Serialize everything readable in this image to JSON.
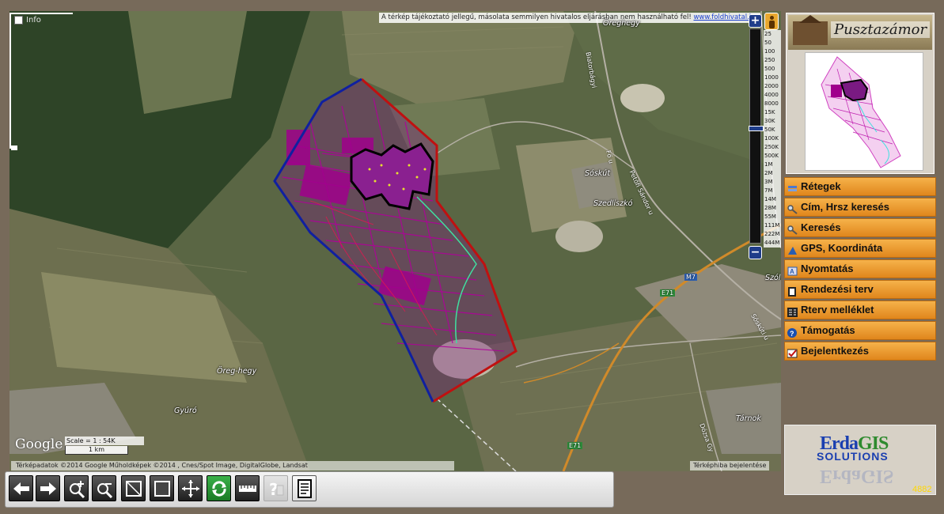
{
  "map": {
    "notice_text": "A térkép tájékoztató jellegű, másolata semmilyen hivatalos eljárásban nem használható fel!",
    "notice_link": "www.foldhivatal.hu",
    "info_label": "Info",
    "places": {
      "oreghegy_top": "Öreghegy",
      "soskut": "Sóskút",
      "szedliszko": "Szedliszkó",
      "oreg_hegy": "Öreg-hegy",
      "gyuro": "Gyúró",
      "tarnok": "Tárnok",
      "szol": "Szól"
    },
    "roads": {
      "biatori": "Biatorbágyi",
      "fo_u": "Fő u",
      "petofi": "Petőfi Sándor u",
      "soskuti": "Sóskúti u",
      "dozsa": "Dózsa Gy",
      "m7": "M7",
      "e71a": "E71",
      "e71b": "E71"
    },
    "google_label": "Google",
    "scale_label": "Scale = 1 : 54K",
    "scale_bar": "1 km",
    "attribution": "Térképadatok ©2014 Google Műholdképek ©2014 , Cnes/Spot Image, DigitalGlobe, Landsat",
    "report_link": "Térképhiba bejelentése"
  },
  "zoom": {
    "levels": [
      "25",
      "50",
      "100",
      "250",
      "500",
      "1000",
      "2000",
      "4000",
      "8000",
      "15K",
      "30K",
      "50K",
      "100K",
      "250K",
      "500K",
      "1M",
      "2M",
      "3M",
      "7M",
      "14M",
      "28M",
      "55M",
      "111M",
      "222M",
      "444M"
    ],
    "current_level": "50K",
    "plus": "+",
    "minus": "−"
  },
  "panel": {
    "logo_title": "Pusztazámor",
    "menu": [
      {
        "label": "Rétegek",
        "icon": "layers-icon"
      },
      {
        "label": "Cím, Hrsz keresés",
        "icon": "address-search-icon"
      },
      {
        "label": "Keresés",
        "icon": "search-icon"
      },
      {
        "label": "GPS, Koordináta",
        "icon": "gps-icon"
      },
      {
        "label": "Nyomtatás",
        "icon": "print-icon"
      },
      {
        "label": "Rendezési terv",
        "icon": "plan-icon"
      },
      {
        "label": "Rterv melléklet",
        "icon": "attachment-icon"
      },
      {
        "label": "Támogatás",
        "icon": "help-icon"
      },
      {
        "label": "Bejelentkezés",
        "icon": "login-icon"
      }
    ],
    "brand_erda": "Erda",
    "brand_gis": "GIS",
    "brand_solutions": "SOLUTIONS",
    "counter": "4882"
  },
  "colors": {
    "menu_orange": "#f0a030",
    "parcel_magenta": "#a0008c",
    "border_red": "#c01010",
    "border_blue": "#1020a0"
  },
  "toolbar": {
    "tools": [
      "back-arrow-icon",
      "forward-arrow-icon",
      "zoom-in-icon",
      "zoom-out-icon",
      "zoom-rect-icon",
      "full-extent-icon",
      "pan-icon",
      "refresh-icon",
      "measure-icon",
      "help-disabled-icon",
      "document-icon"
    ]
  }
}
